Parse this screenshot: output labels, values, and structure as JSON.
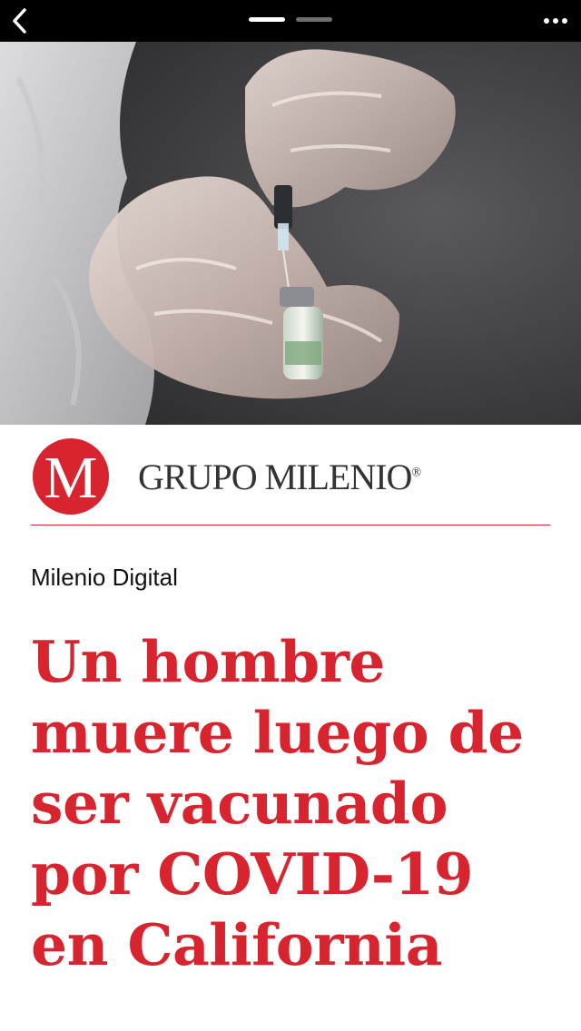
{
  "nav": {
    "back_icon": "chevron-left-icon",
    "more_icon": "ellipsis-horizontal-icon",
    "pages": [
      {
        "active": true
      },
      {
        "active": false
      }
    ]
  },
  "hero_image": {
    "subject": "gloved hands holding a vaccine vial and syringe"
  },
  "publisher": {
    "logo_letter": "M",
    "name": "GRUPO MILENIO",
    "registered_mark": "®",
    "brand_color": "#d8242f"
  },
  "article": {
    "byline": "Milenio Digital",
    "headline_lines": [
      "Un hombre",
      "muere luego de",
      "ser vacunado",
      "por COVID-19",
      "en California"
    ],
    "headline_color": "#d8242f"
  }
}
